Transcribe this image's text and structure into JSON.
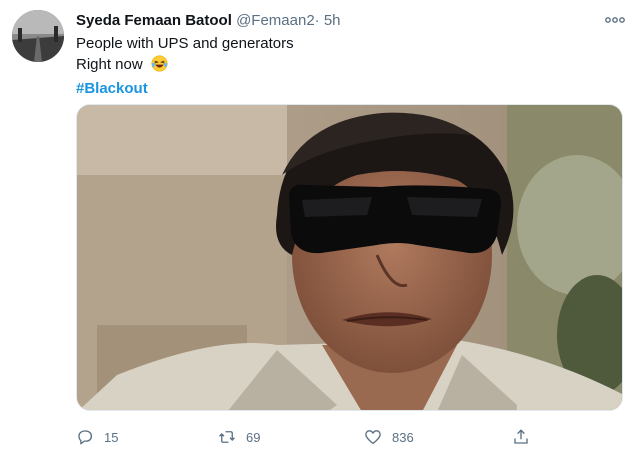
{
  "tweet": {
    "author_name": "Syeda Femaan Batool",
    "handle": "@Femaan2",
    "separator": "·",
    "time": "5h",
    "line1": "People with UPS and generators",
    "line2": "Right now",
    "emoji": "😂",
    "hashtag": "#Blackout"
  },
  "actions": {
    "reply_count": "15",
    "retweet_count": "69",
    "like_count": "836"
  },
  "icons": [
    "more-icon",
    "reply-icon",
    "retweet-icon",
    "like-icon",
    "share-icon",
    "laughing-emoji-icon"
  ],
  "colors": {
    "hashtag": "#1b95e0",
    "secondary_text": "#5b7083"
  }
}
